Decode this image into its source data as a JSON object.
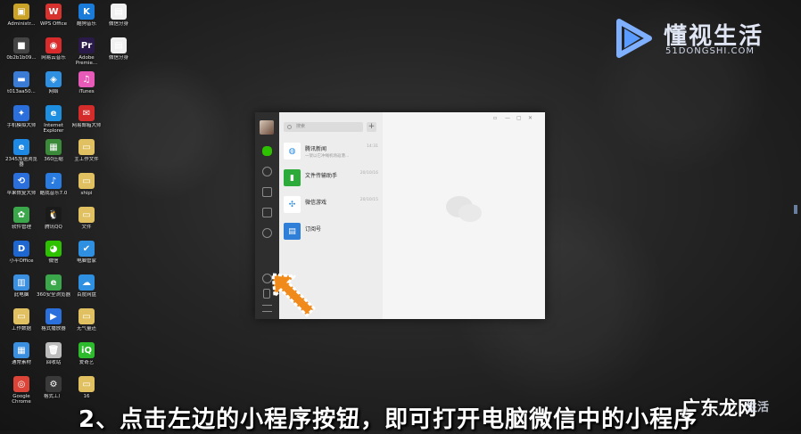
{
  "desktop_icons": [
    {
      "label": "Administr...",
      "color": "#c9a227",
      "glyph": "▣"
    },
    {
      "label": "WPS Office",
      "color": "#d8322f",
      "glyph": "W"
    },
    {
      "label": "酷狗音乐",
      "color": "#1a7bd8",
      "glyph": "K"
    },
    {
      "label": "微信分身",
      "color": "#f0f0f0",
      "glyph": "▤"
    },
    {
      "label": "0b2b1b09...",
      "color": "#444444",
      "glyph": "■"
    },
    {
      "label": "网易云音乐",
      "color": "#d92b2b",
      "glyph": "◉"
    },
    {
      "label": "Adobe Premie...",
      "color": "#2a1a4a",
      "glyph": "Pr"
    },
    {
      "label": "微信分身",
      "color": "#f0f0f0",
      "glyph": "▤"
    },
    {
      "label": "t013aa50...",
      "color": "#3a7bd5",
      "glyph": "▬"
    },
    {
      "label": "网络",
      "color": "#2f8fe0",
      "glyph": "◈"
    },
    {
      "label": "iTunes",
      "color": "#e85ab8",
      "glyph": "♫"
    },
    {
      "label": "手机模拟大师",
      "color": "#2a6fdb",
      "glyph": "✦"
    },
    {
      "label": "Internet Explorer",
      "color": "#1e8fe0",
      "glyph": "e"
    },
    {
      "label": "网易邮箱大师",
      "color": "#d42b2b",
      "glyph": "✉"
    },
    {
      "label": "2345加速浏览器",
      "color": "#1e88e5",
      "glyph": "e"
    },
    {
      "label": "360压缩",
      "color": "#3a8a3a",
      "glyph": "▦"
    },
    {
      "label": "主工作文件",
      "color": "#e0c060",
      "glyph": "▭"
    },
    {
      "label": "苹果恢复大师",
      "color": "#2a6fdb",
      "glyph": "⟲"
    },
    {
      "label": "酷我音乐7.0",
      "color": "#2a7be0",
      "glyph": "♪"
    },
    {
      "label": "shipi",
      "color": "#e0c060",
      "glyph": "▭"
    },
    {
      "label": "软件管理",
      "color": "#3aa84a",
      "glyph": "✿"
    },
    {
      "label": "腾讯QQ",
      "color": "#1a1a1a",
      "glyph": "🐧"
    },
    {
      "label": "文件",
      "color": "#e0c060",
      "glyph": "▭"
    },
    {
      "label": "小平Office",
      "color": "#1e66d0",
      "glyph": "D"
    },
    {
      "label": "微信",
      "color": "#2dc100",
      "glyph": "◕"
    },
    {
      "label": "电脑管家",
      "color": "#2f8fe0",
      "glyph": "✔"
    },
    {
      "label": "此电脑",
      "color": "#3a8fe0",
      "glyph": "▥"
    },
    {
      "label": "360安全浏览器",
      "color": "#3aa84a",
      "glyph": "e"
    },
    {
      "label": "百度网盘",
      "color": "#2f8fe0",
      "glyph": "☁"
    },
    {
      "label": "工作数据",
      "color": "#e0c060",
      "glyph": "▭"
    },
    {
      "label": "格式播放器",
      "color": "#2a6fdb",
      "glyph": "▶"
    },
    {
      "label": "无气量还",
      "color": "#e0c060",
      "glyph": "▭"
    },
    {
      "label": "通常素材",
      "color": "#3a8fe0",
      "glyph": "▦"
    },
    {
      "label": "回收站",
      "color": "#bbbbbb",
      "glyph": "🗑"
    },
    {
      "label": "爱奇艺",
      "color": "#2dbb2d",
      "glyph": "iQ"
    },
    {
      "label": "Google Chrome",
      "color": "#db4437",
      "glyph": "◎"
    },
    {
      "label": "格式工厂",
      "color": "#3a3a3a",
      "glyph": "⚙"
    },
    {
      "label": "16",
      "color": "#e0c060",
      "glyph": "▭"
    }
  ],
  "logo": {
    "brand": "懂视生活",
    "domain": "51DONGSHI.COM"
  },
  "wechat": {
    "search_placeholder": "搜索",
    "plus_label": "+",
    "chats": [
      {
        "name": "腾讯新闻",
        "time": "14:31",
        "preview": "一架以它冲绳机场返港...",
        "color": "#ffffff",
        "glyph": "◍"
      },
      {
        "name": "文件传输助手",
        "time": "20/10/16",
        "preview": "",
        "color": "#2dab3a",
        "glyph": "▮"
      },
      {
        "name": "微信游戏",
        "time": "20/10/15",
        "preview": "",
        "color": "#ffffff",
        "glyph": "✣"
      },
      {
        "name": "订阅号",
        "time": "",
        "preview": "",
        "color": "#2f7fd8",
        "glyph": "▤"
      }
    ],
    "window_buttons": [
      "▫",
      "—",
      "▢",
      "✕"
    ]
  },
  "subtitle": "2、点击左边的小程序按钮，即可打开电脑微信中的小程序",
  "corner_mark": "广东龙网",
  "corner_brand": "生活"
}
